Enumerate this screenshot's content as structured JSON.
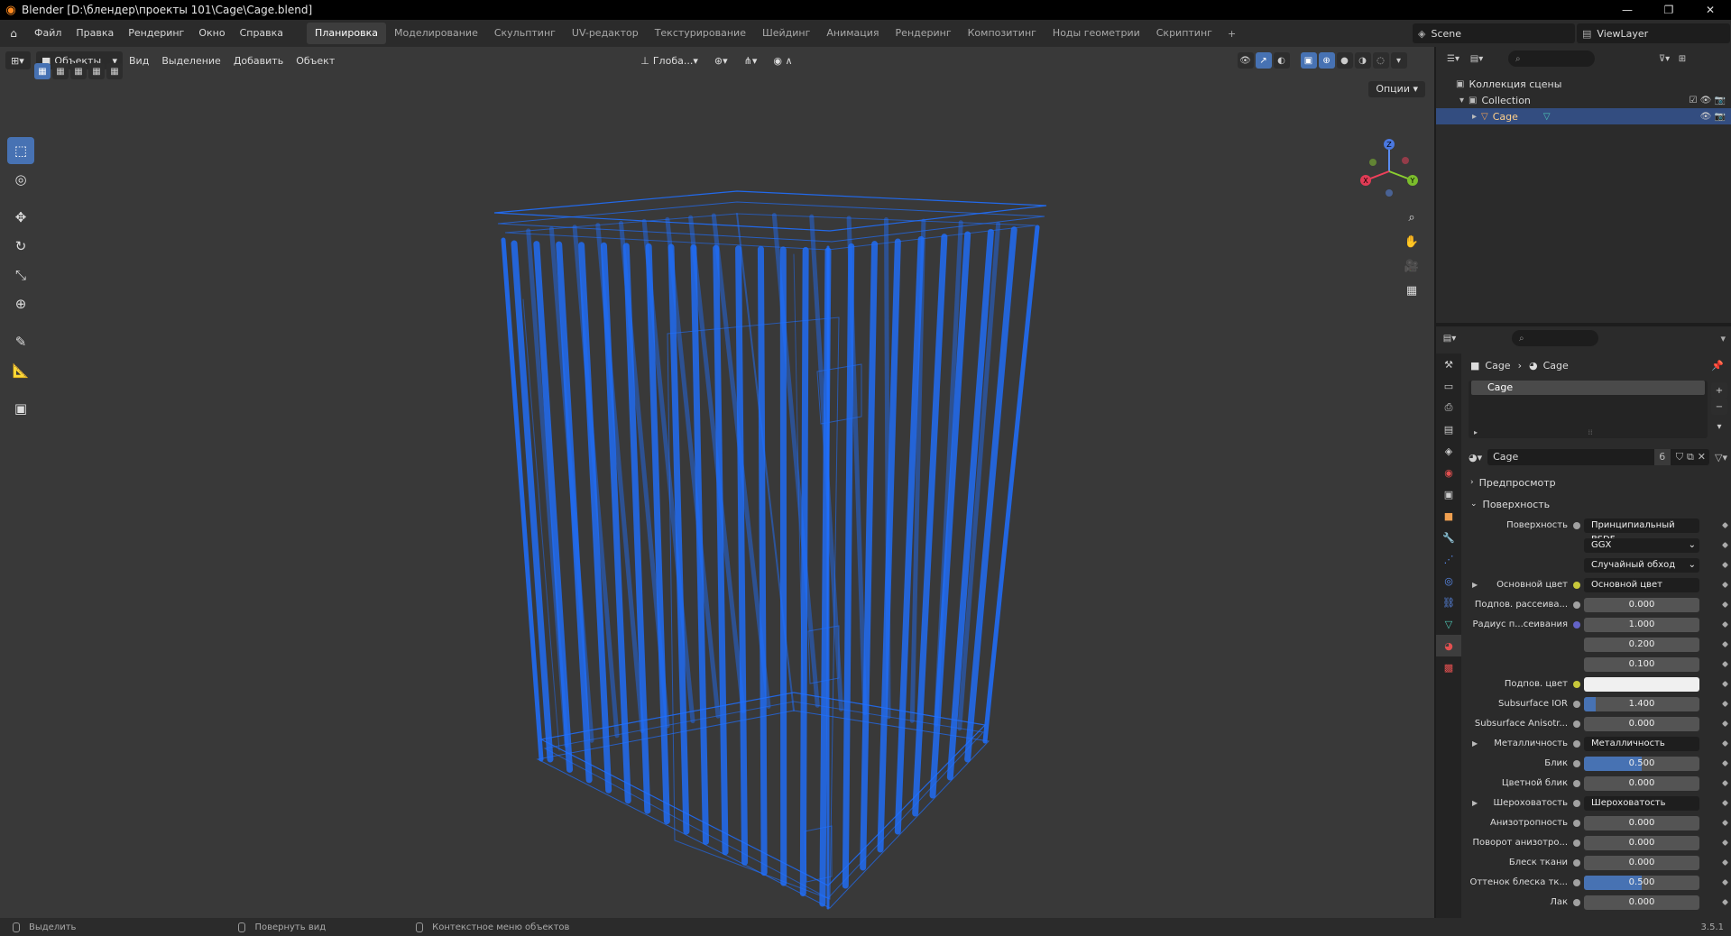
{
  "window": {
    "title": "Blender [D:\\блендер\\проекты 101\\Cage\\Cage.blend]",
    "buttons": [
      "—",
      "❐",
      "✕"
    ]
  },
  "menu": {
    "items": [
      "Файл",
      "Правка",
      "Рендеринг",
      "Окно",
      "Справка"
    ]
  },
  "workspaces": {
    "tabs": [
      "Планировка",
      "Моделирование",
      "Скульптинг",
      "UV-редактор",
      "Текстурирование",
      "Шейдинг",
      "Анимация",
      "Рендеринг",
      "Композитинг",
      "Ноды геометрии",
      "Скриптинг"
    ],
    "active": "Планировка",
    "add": "+"
  },
  "scene": {
    "name": "Scene",
    "view_layer": "ViewLayer"
  },
  "viewport": {
    "mode": "Объекты",
    "menus": [
      "Вид",
      "Выделение",
      "Добавить",
      "Объект"
    ],
    "transform_orientation": "Глоба...",
    "options": "Опции",
    "wire_color": "#1f6fff",
    "bg_color": "#393939",
    "gizmo_labels": {
      "x": "X",
      "y": "Y",
      "z": "Z"
    }
  },
  "toolbar": {
    "tools": [
      "select-box",
      "cursor",
      "move",
      "rotate",
      "scale",
      "transform",
      "annotate",
      "measure",
      "add-cube"
    ]
  },
  "outliner": {
    "search_placeholder": "",
    "items": [
      {
        "label": "Коллекция сцены",
        "level": 0
      },
      {
        "label": "Collection",
        "level": 1
      },
      {
        "label": "Cage",
        "level": 2,
        "selected": true
      }
    ]
  },
  "properties": {
    "breadcrumb": {
      "object": "Cage",
      "material": "Cage"
    },
    "slot": "Cage",
    "material": {
      "name": "Cage",
      "users": "6"
    },
    "panels": {
      "preview": "Предпросмотр",
      "surface": "Поверхность"
    },
    "rows": [
      {
        "label": "Поверхность",
        "value": "Принципиальный BSDF",
        "kind": "dark",
        "dot": "gray"
      },
      {
        "label": "",
        "value": "GGX",
        "kind": "dd"
      },
      {
        "label": "",
        "value": "Случайный обход",
        "kind": "dd"
      },
      {
        "label": "Основной цвет",
        "value": "Основной цвет",
        "kind": "dark",
        "dot": "yellow",
        "expand": true
      },
      {
        "label": "Подпов. рассеива...",
        "value": "0.000",
        "kind": "num",
        "dot": "gray"
      },
      {
        "label": "Радиус п...сеивания",
        "value": "1.000",
        "kind": "num",
        "dot": "blue"
      },
      {
        "label": "",
        "value": "0.200",
        "kind": "num"
      },
      {
        "label": "",
        "value": "0.100",
        "kind": "num"
      },
      {
        "label": "Подпов. цвет",
        "value": "",
        "kind": "white",
        "dot": "yellow"
      },
      {
        "label": "Subsurface IOR",
        "value": "1.400",
        "kind": "num",
        "dot": "gray",
        "fill": 0.1
      },
      {
        "label": "Subsurface Anisotr...",
        "value": "0.000",
        "kind": "num",
        "dot": "gray"
      },
      {
        "label": "Металличность",
        "value": "Металличность",
        "kind": "dark",
        "dot": "gray",
        "expand": true
      },
      {
        "label": "Блик",
        "value": "0.500",
        "kind": "num",
        "dot": "gray",
        "fill": 0.5
      },
      {
        "label": "Цветной блик",
        "value": "0.000",
        "kind": "num",
        "dot": "gray"
      },
      {
        "label": "Шероховатость",
        "value": "Шероховатость",
        "kind": "dark",
        "dot": "gray",
        "expand": true
      },
      {
        "label": "Анизотропность",
        "value": "0.000",
        "kind": "num",
        "dot": "gray"
      },
      {
        "label": "Поворот анизотро...",
        "value": "0.000",
        "kind": "num",
        "dot": "gray"
      },
      {
        "label": "Блеск ткани",
        "value": "0.000",
        "kind": "num",
        "dot": "gray"
      },
      {
        "label": "Оттенок блеска тк...",
        "value": "0.500",
        "kind": "num",
        "dot": "gray",
        "fill": 0.5
      },
      {
        "label": "Лак",
        "value": "0.000",
        "kind": "num",
        "dot": "gray"
      }
    ]
  },
  "status": {
    "hints": [
      "Выделить",
      "Повернуть вид",
      "Контекстное меню объектов"
    ],
    "version": "3.5.1"
  }
}
